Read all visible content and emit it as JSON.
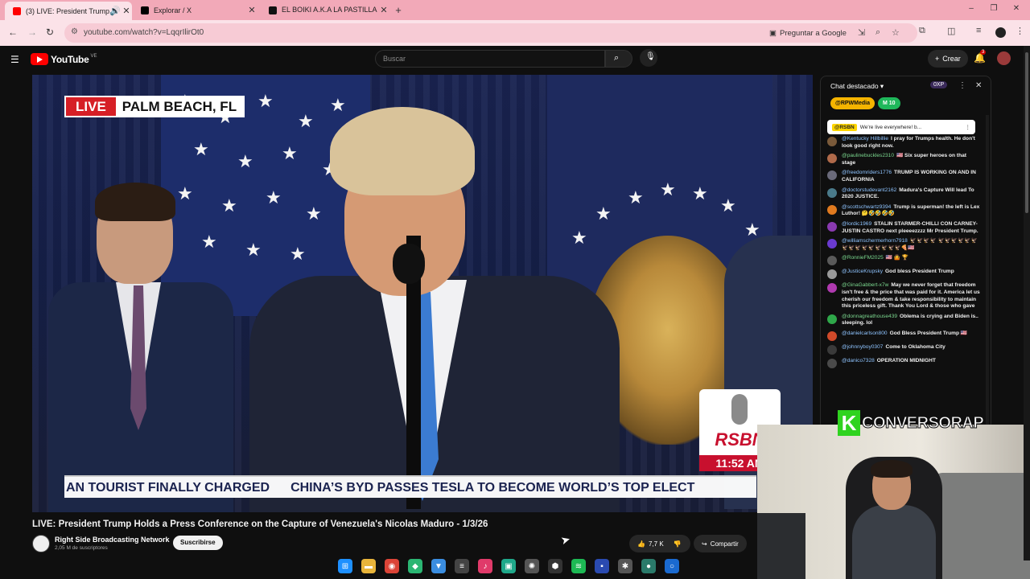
{
  "browser": {
    "tabs": [
      {
        "title": "(3) LIVE: President Trump Hi",
        "favicon_color": "#ff0000",
        "active": true
      },
      {
        "title": "Explorar / X",
        "favicon_color": "#000000",
        "active": false
      },
      {
        "title": "EL BOIKI A.K.A LA PASTILLA 💊",
        "favicon_color": "#111111",
        "active": false
      }
    ],
    "url": "youtube.com/watch?v=LqqrIlirOt0",
    "ask_google": "Preguntar a Google"
  },
  "youtube": {
    "logo": "YouTube",
    "country_code": "VE",
    "search_placeholder": "Buscar",
    "create_label": "Crear",
    "notif_count": "3"
  },
  "video": {
    "live_label": "LIVE",
    "location": "PALM BEACH, FL",
    "network_logo": "RSBN",
    "time_tag": "11:52 AM",
    "ticker_left": "AN TOURIST FINALLY CHARGED",
    "ticker_right": "CHINA’S BYD PASSES TESLA TO BECOME WORLD’S TOP ELECT"
  },
  "info": {
    "title": "LIVE: President Trump Holds a Press Conference on the Capture of Venezuela's Nicolas Maduro - 1/3/26",
    "channel": "Right Side Broadcasting Network",
    "subscribers": "2,05 M de suscriptores",
    "subscribe_label": "Suscribirse",
    "likes": "7,7 K",
    "share_label": "Compartir"
  },
  "chat": {
    "title": "Chat destacado",
    "xp": "0XP",
    "ticker_chips": [
      {
        "label": "@RPWMedia",
        "color": "#f5b400"
      },
      {
        "label": "M 10",
        "color": "#1fb85b"
      }
    ],
    "pinned_author": "@RSBN",
    "pinned_text": "We're live everywhere! b...",
    "messages": [
      {
        "author": "@Kentucky Hillbillie",
        "text": "I pray for Trumps health. He don't look good right now.",
        "avatar": "#7a5a3a",
        "green": false
      },
      {
        "author": "@paulinebuckles2310",
        "text": "🇺🇸 Six super heroes on that stage",
        "avatar": "#b06a4a",
        "green": true
      },
      {
        "author": "@freedomriders1776",
        "text": "TRUMP IS WORKING ON AND IN CALIFORNIA",
        "avatar": "#6a6a7a",
        "green": false
      },
      {
        "author": "@doctorstudevant2162",
        "text": "Madura's Capture Will lead To 2020 JUSTICE.",
        "avatar": "#4a7a8a",
        "green": false
      },
      {
        "author": "@scottschwartz9394",
        "text": "Trump is superman! the left is Lex Luthor! 🤔🤣🤣🤣🤣",
        "avatar": "#e07a1f",
        "green": false
      },
      {
        "author": "@lordic1969",
        "text": "STALIN STARMER-CHILLI CON CARNEY-JUSTIN CASTRO next pleeeezzzz Mr President Trump.",
        "avatar": "#8a3ab0",
        "green": false
      },
      {
        "author": "@williamschermerhorn7918",
        "text": "🦅🦅🦅🦅 🦅🦅🦅🦅🦅🦅🦅🦅🦅🦅🦅🦅🦅🦅🦅🍕🇺🇸",
        "avatar": "#6a3ad0",
        "green": false
      },
      {
        "author": "@RonnieFM2025",
        "text": "🇺🇸 🤷 🏆",
        "avatar": "#5a5a5a",
        "green": true
      },
      {
        "author": "@JusticeKrupsky",
        "text": "God bless President Trump",
        "avatar": "#9a9a9a",
        "green": false
      },
      {
        "author": "@GinaGabbert-x7w",
        "text": "May we never forget that freedom isn't free & the price that was paid for it. America let us cherish our freedom & take responsibility to maintain this priceless gift. Thank You Lord & those who gave",
        "avatar": "#b03ab0",
        "green": true
      },
      {
        "author": "@donnagreathouse439",
        "text": "Oblema is crying and Biden is.. sleeping. lol",
        "avatar": "#2fa84a",
        "green": true
      },
      {
        "author": "@danielcarlson800",
        "text": "God Bless President Trump 🇺🇸",
        "avatar": "#d04a2a",
        "green": false
      },
      {
        "author": "@johnnyboy0307",
        "text": "Come to Oklahoma City",
        "avatar": "#3a3a3a",
        "green": false
      },
      {
        "author": "@danico7328",
        "text": "OPERATION MIDNIGHT",
        "avatar": "#4a4a4a",
        "green": false
      }
    ]
  },
  "overlay": {
    "brand_letter": "K",
    "brand_name": "CONVERSORAP"
  },
  "taskbar": [
    {
      "icon": "windows-icon",
      "color": "#1e90ff",
      "glyph": "⊞"
    },
    {
      "icon": "folder-icon",
      "color": "#e8b43a",
      "glyph": "▬"
    },
    {
      "icon": "chrome-icon",
      "color": "#db4437",
      "glyph": "◉"
    },
    {
      "icon": "app-green-icon",
      "color": "#2bb673",
      "glyph": "◆"
    },
    {
      "icon": "app-blue-icon",
      "color": "#3a8de0",
      "glyph": "▼"
    },
    {
      "icon": "app-gray-icon",
      "color": "#444444",
      "glyph": "≡"
    },
    {
      "icon": "tiktok-icon",
      "color": "#e03a6a",
      "glyph": "♪"
    },
    {
      "icon": "app-teal-icon",
      "color": "#1fa88a",
      "glyph": "▣"
    },
    {
      "icon": "chatgpt-icon",
      "color": "#555555",
      "glyph": "✺"
    },
    {
      "icon": "steam-icon",
      "color": "#333333",
      "glyph": "⬢"
    },
    {
      "icon": "spotify-icon",
      "color": "#1db954",
      "glyph": "≋"
    },
    {
      "icon": "app-navy-icon",
      "color": "#2a4ab0",
      "glyph": "▪"
    },
    {
      "icon": "settings-icon",
      "color": "#555555",
      "glyph": "✱"
    },
    {
      "icon": "app-circle-icon",
      "color": "#2a7a6a",
      "glyph": "●"
    },
    {
      "icon": "app-ring-icon",
      "color": "#1a6ad0",
      "glyph": "○"
    }
  ]
}
